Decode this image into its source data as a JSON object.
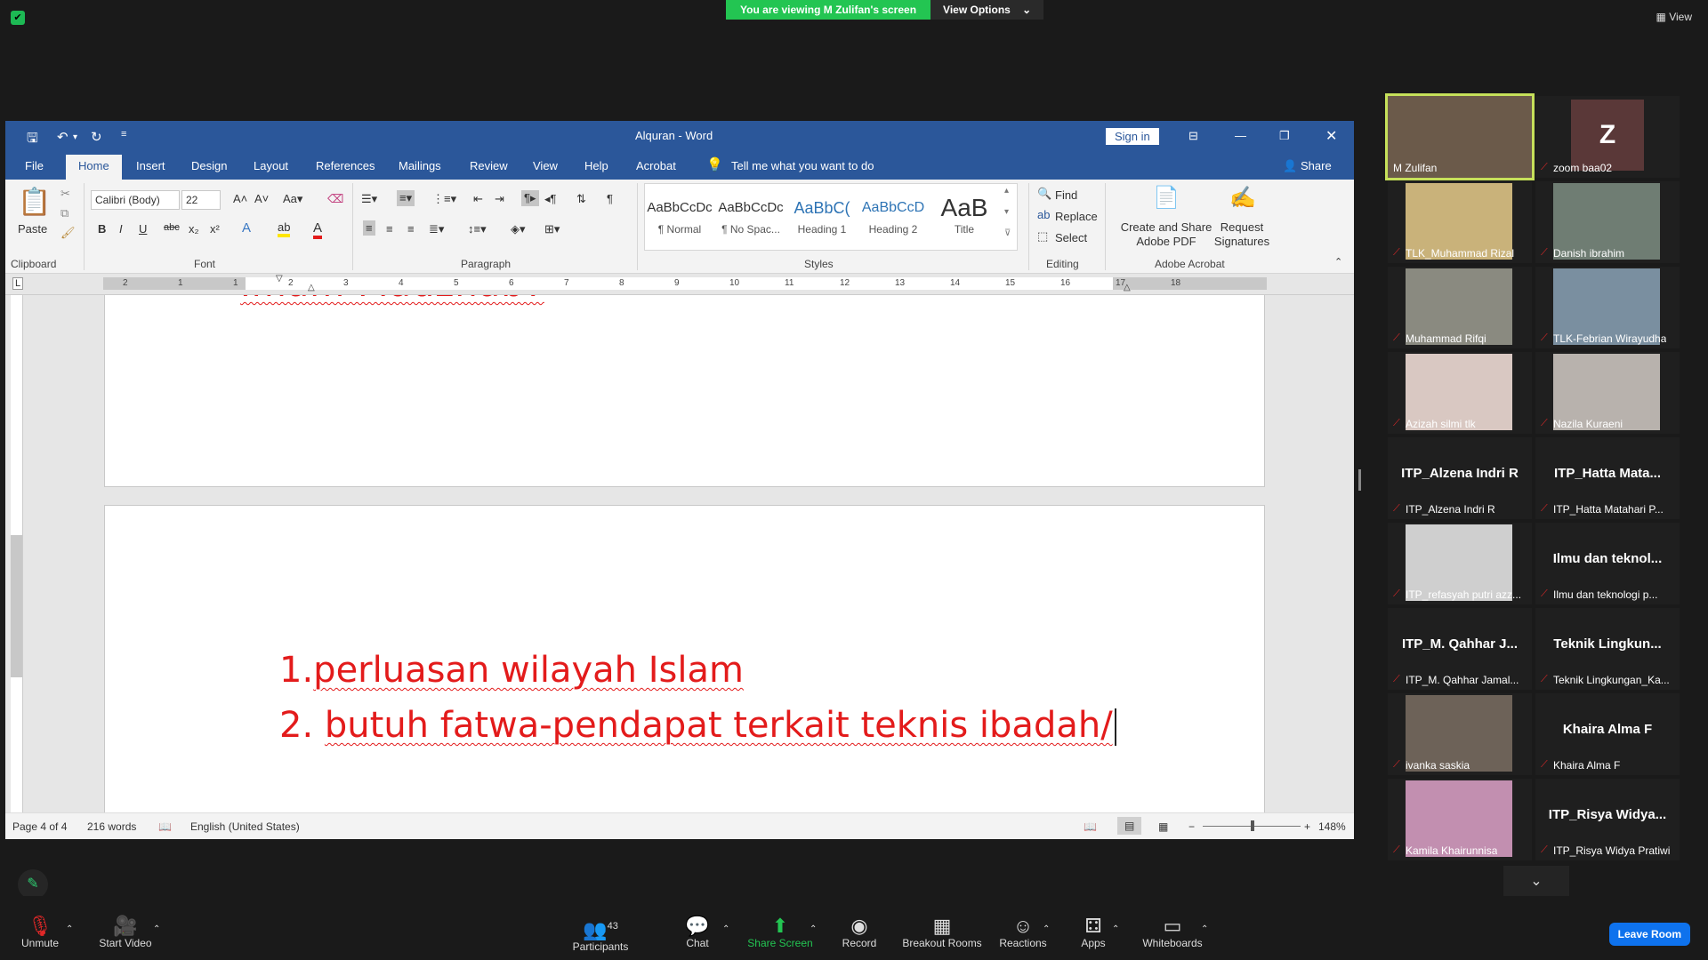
{
  "zoom": {
    "banner_viewing": "You are viewing M Zulifan's screen",
    "banner_view_options": "View Options",
    "view_button": "View",
    "participants_count": "43",
    "toolbar": [
      {
        "label": "Unmute",
        "icon": "mic-muted-icon"
      },
      {
        "label": "Start Video",
        "icon": "video-off-icon"
      },
      {
        "label": "Participants",
        "icon": "participants-icon"
      },
      {
        "label": "Chat",
        "icon": "chat-icon"
      },
      {
        "label": "Share Screen",
        "icon": "share-screen-icon"
      },
      {
        "label": "Record",
        "icon": "record-icon"
      },
      {
        "label": "Breakout Rooms",
        "icon": "breakout-rooms-icon"
      },
      {
        "label": "Reactions",
        "icon": "reactions-icon"
      },
      {
        "label": "Apps",
        "icon": "apps-icon"
      },
      {
        "label": "Whiteboards",
        "icon": "whiteboards-icon"
      }
    ],
    "leave_label": "Leave Room",
    "gallery": [
      {
        "name": "M Zulifan",
        "big": "",
        "video": true,
        "color": "#6b5a4a"
      },
      {
        "name": "zoom baa02",
        "big": "Z",
        "video": false,
        "color": "#5a3838"
      },
      {
        "name": "TLK_Muhammad Rizal",
        "big": "",
        "video": true,
        "color": "#c9b27a"
      },
      {
        "name": "Danish ibrahim",
        "big": "",
        "video": true,
        "color": "#6f7d73"
      },
      {
        "name": "Muhammad Rifqi",
        "big": "",
        "video": true,
        "color": "#8a8a80"
      },
      {
        "name": "TLK-Febrian Wirayudha",
        "big": "",
        "video": true,
        "color": "#7a8fa0"
      },
      {
        "name": "Azizah silmi tlk",
        "big": "",
        "video": true,
        "color": "#d9c8c2"
      },
      {
        "name": "Nazila Kuraeni",
        "big": "",
        "video": true,
        "color": "#b8b2ad"
      },
      {
        "name": "ITP_Alzena Indri R",
        "big": "ITP_Alzena Indri R",
        "video": false,
        "color": "#1f1f1f"
      },
      {
        "name": "ITP_Hatta Matahari P...",
        "big": "ITP_Hatta Mata...",
        "video": false,
        "color": "#1f1f1f"
      },
      {
        "name": "ITP_refasyah putri azz...",
        "big": "",
        "video": true,
        "color": "#cfcfcf"
      },
      {
        "name": "Ilmu dan teknologi p...",
        "big": "Ilmu dan teknol...",
        "video": false,
        "color": "#1f1f1f"
      },
      {
        "name": "ITP_M. Qahhar Jamal...",
        "big": "ITP_M. Qahhar J...",
        "video": false,
        "color": "#1f1f1f"
      },
      {
        "name": "Teknik Lingkungan_Ka...",
        "big": "Teknik Lingkun...",
        "video": false,
        "color": "#1f1f1f"
      },
      {
        "name": "ivanka saskia",
        "big": "",
        "video": true,
        "color": "#6d6258"
      },
      {
        "name": "Khaira Alma F",
        "big": "Khaira Alma F",
        "video": false,
        "color": "#1f1f1f"
      },
      {
        "name": "Kamila Khairunnisa",
        "big": "",
        "video": true,
        "color": "#c28fb0"
      },
      {
        "name": "ITP_Risya Widya Pratiwi",
        "big": "ITP_Risya Widya...",
        "video": false,
        "color": "#1f1f1f"
      }
    ]
  },
  "word": {
    "title": "Alquran  -  Word",
    "sign_in": "Sign in",
    "menu": [
      "File",
      "Home",
      "Insert",
      "Design",
      "Layout",
      "References",
      "Mailings",
      "Review",
      "View",
      "Help",
      "Acrobat"
    ],
    "tell_me": "Tell me what you want to do",
    "share": "Share",
    "clipboard": {
      "paste": "Paste",
      "label": "Clipboard"
    },
    "font": {
      "name": "Calibri (Body)",
      "size": "22",
      "label": "Font"
    },
    "paragraph_label": "Paragraph",
    "styles": [
      {
        "preview": "AaBbCcDc",
        "name": "¶ Normal"
      },
      {
        "preview": "AaBbCcDc",
        "name": "¶ No Spac..."
      },
      {
        "preview": "AaBbC(",
        "name": "Heading 1"
      },
      {
        "preview": "AaBbCcD",
        "name": "Heading 2"
      },
      {
        "preview": "AaB",
        "name": "Title"
      }
    ],
    "styles_label": "Styles",
    "editing": {
      "find": "Find",
      "replace": "Replace",
      "select": "Select",
      "label": "Editing"
    },
    "acrobat": {
      "create": "Create and Share",
      "create2": "Adobe PDF",
      "request": "Request",
      "request2": "Signatures",
      "label": "Adobe Acrobat"
    },
    "ruler_numbers": [
      "2",
      "1",
      "1",
      "2",
      "3",
      "4",
      "5",
      "6",
      "7",
      "8",
      "9",
      "10",
      "11",
      "12",
      "13",
      "14",
      "15",
      "16",
      "17",
      "18"
    ],
    "doc": {
      "prev_heading": "Imam Madzhab?",
      "line1_num": "1.",
      "line1_text": "perluasan wilayah Islam",
      "line2_num": "2.",
      "line2_text": "butuh fatwa-pendapat terkait teknis ibadah/"
    },
    "status": {
      "page": "Page 4 of 4",
      "words": "216 words",
      "language": "English (United States)",
      "zoom": "148%"
    }
  }
}
